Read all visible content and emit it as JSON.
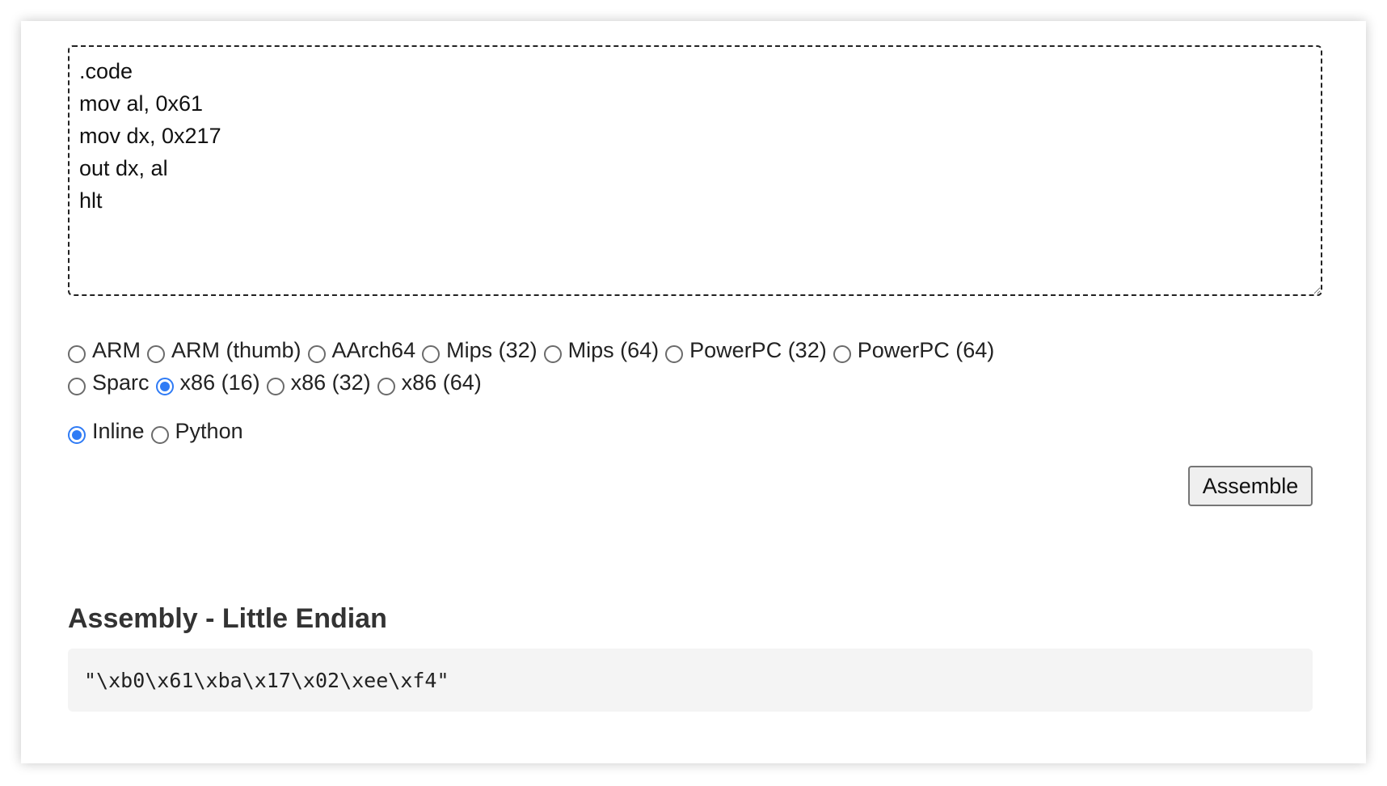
{
  "editor": {
    "code": ".code\nmov al, 0x61\nmov dx, 0x217\nout dx, al\nhlt"
  },
  "architectures": [
    {
      "label": "ARM",
      "checked": false
    },
    {
      "label": "ARM (thumb)",
      "checked": false
    },
    {
      "label": "AArch64",
      "checked": false
    },
    {
      "label": "Mips (32)",
      "checked": false
    },
    {
      "label": "Mips (64)",
      "checked": false
    },
    {
      "label": "PowerPC (32)",
      "checked": false
    },
    {
      "label": "PowerPC (64)",
      "checked": false
    },
    {
      "label": "Sparc",
      "checked": false
    },
    {
      "label": "x86 (16)",
      "checked": true
    },
    {
      "label": "x86 (32)",
      "checked": false
    },
    {
      "label": "x86 (64)",
      "checked": false
    }
  ],
  "formats": [
    {
      "label": "Inline",
      "checked": true
    },
    {
      "label": "Python",
      "checked": false
    }
  ],
  "actions": {
    "assemble_label": "Assemble"
  },
  "result": {
    "title": "Assembly - Little Endian",
    "output": "\"\\xb0\\x61\\xba\\x17\\x02\\xee\\xf4\""
  },
  "colors": {
    "accent": "#2f7bf5",
    "output_bg": "#f4f4f4"
  }
}
